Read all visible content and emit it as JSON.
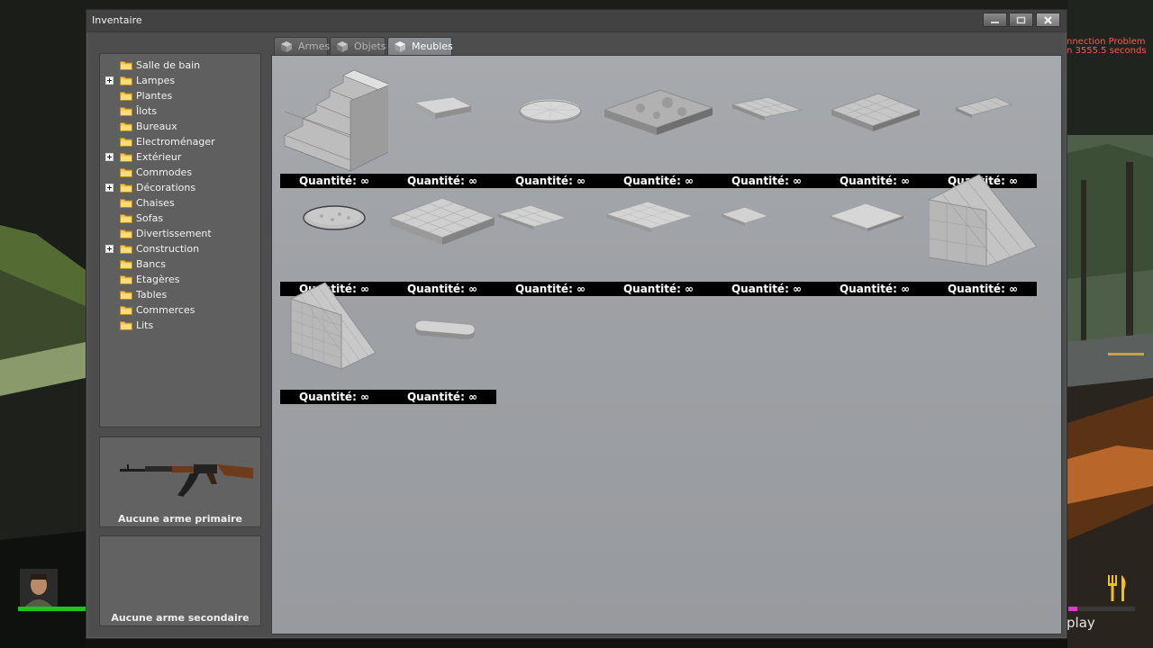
{
  "hud": {
    "problem_text": "nnection Problem",
    "seconds_text": "n 3555.5 seconds",
    "roleplay_text": "play",
    "hunger_level": 0.14
  },
  "window": {
    "title": "Inventaire"
  },
  "categories": [
    {
      "label": "Salle de bain",
      "expandable": false
    },
    {
      "label": "Lampes",
      "expandable": true
    },
    {
      "label": "Plantes",
      "expandable": false
    },
    {
      "label": "Îlots",
      "expandable": false
    },
    {
      "label": "Bureaux",
      "expandable": false
    },
    {
      "label": "Electroménager",
      "expandable": false
    },
    {
      "label": "Extérieur",
      "expandable": true
    },
    {
      "label": "Commodes",
      "expandable": false
    },
    {
      "label": "Décorations",
      "expandable": true
    },
    {
      "label": "Chaises",
      "expandable": false
    },
    {
      "label": "Sofas",
      "expandable": false
    },
    {
      "label": "Divertissement",
      "expandable": false
    },
    {
      "label": "Construction",
      "expandable": true
    },
    {
      "label": "Bancs",
      "expandable": false
    },
    {
      "label": "Etagères",
      "expandable": false
    },
    {
      "label": "Tables",
      "expandable": false
    },
    {
      "label": "Commerces",
      "expandable": false
    },
    {
      "label": "Lits",
      "expandable": false
    }
  ],
  "slots": {
    "primary_label": "Aucune arme primaire",
    "secondary_label": "Aucune arme secondaire"
  },
  "tabs": [
    {
      "label": "Armes",
      "active": false
    },
    {
      "label": "Objets",
      "active": false
    },
    {
      "label": "Meubles",
      "active": true
    }
  ],
  "items": [
    {
      "shape": "stairs-block",
      "quantity_label": "Quantité: ∞"
    },
    {
      "shape": "small-slab",
      "quantity_label": "Quantité: ∞"
    },
    {
      "shape": "round-disc",
      "quantity_label": "Quantité: ∞"
    },
    {
      "shape": "rocky-plate",
      "quantity_label": "Quantité: ∞"
    },
    {
      "shape": "thin-tile-strip",
      "quantity_label": "Quantité: ∞"
    },
    {
      "shape": "tiled-plate",
      "quantity_label": "Quantité: ∞"
    },
    {
      "shape": "thin-tile-small",
      "quantity_label": "Quantité: ∞"
    },
    {
      "shape": "round-disc-dark",
      "quantity_label": "Quantité: ∞"
    },
    {
      "shape": "large-tile-grid",
      "quantity_label": "Quantité: ∞"
    },
    {
      "shape": "flat-tile",
      "quantity_label": "Quantité: ∞"
    },
    {
      "shape": "flat-square",
      "quantity_label": "Quantité: ∞"
    },
    {
      "shape": "small-flat",
      "quantity_label": "Quantité: ∞"
    },
    {
      "shape": "flat-plate",
      "quantity_label": "Quantité: ∞"
    },
    {
      "shape": "ramp-panels",
      "quantity_label": "Quantité: ∞"
    },
    {
      "shape": "stair-ramp",
      "quantity_label": "Quantité: ∞"
    },
    {
      "shape": "rounded-bar",
      "quantity_label": "Quantité: ∞"
    }
  ]
}
